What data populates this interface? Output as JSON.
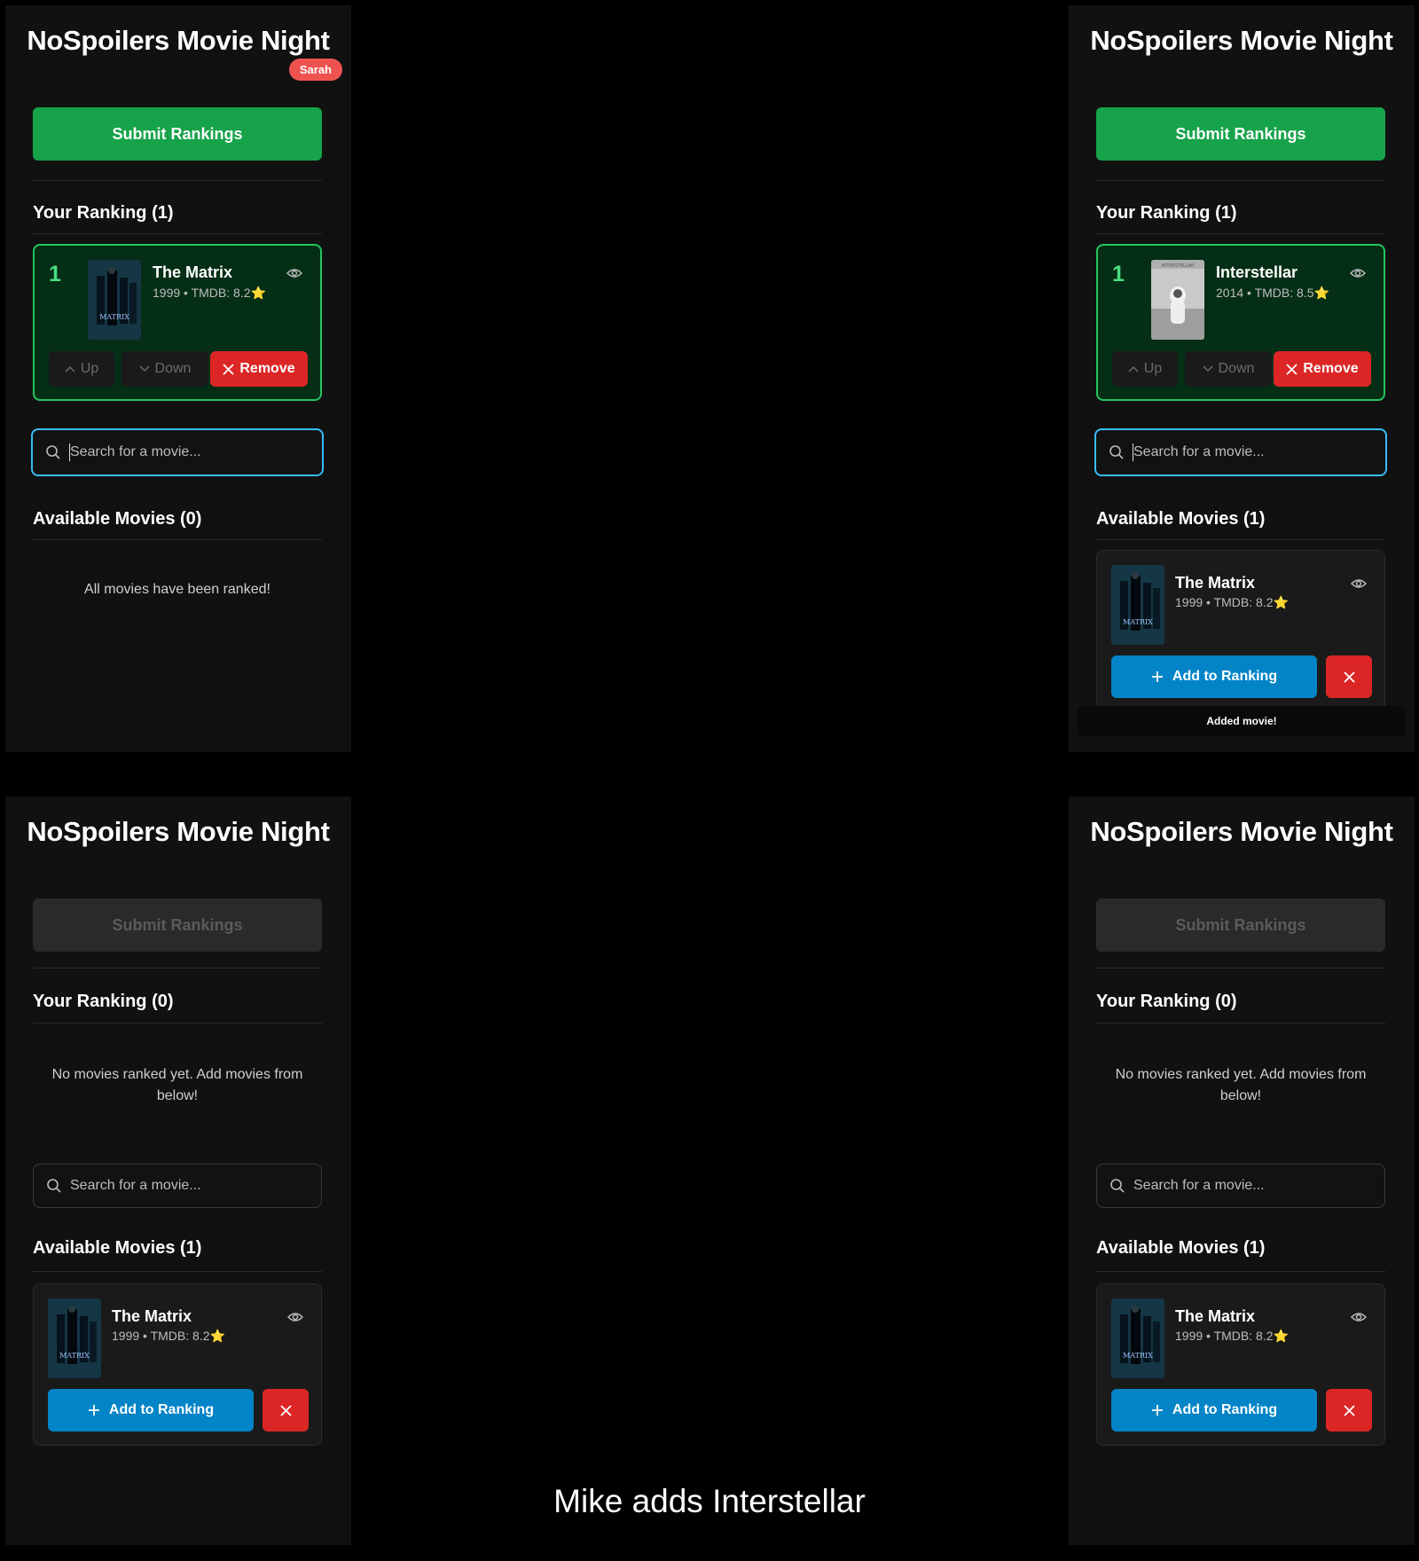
{
  "app": {
    "title": "NoSpoilers Movie Night"
  },
  "labels": {
    "submit": "Submit Rankings",
    "up": "Up",
    "down": "Down",
    "remove": "Remove",
    "add": "Add to Ranking",
    "search_placeholder": "Search for a movie...",
    "empty_ranking": "No movies ranked yet. Add movies from below!",
    "all_ranked": "All movies have been ranked!"
  },
  "panels": {
    "top_left": {
      "user": "Sarah",
      "ranking_header": "Your Ranking (1)",
      "available_header": "Available Movies (0)",
      "ranked": [
        {
          "rank": "1",
          "title": "The Matrix",
          "meta": "1999 • TMDB: 8.2⭐"
        }
      ]
    },
    "top_right": {
      "ranking_header": "Your Ranking (1)",
      "available_header": "Available Movies (1)",
      "ranked": [
        {
          "rank": "1",
          "title": "Interstellar",
          "meta": "2014 • TMDB: 8.5⭐"
        }
      ],
      "available": [
        {
          "title": "The Matrix",
          "meta": "1999 • TMDB: 8.2⭐"
        }
      ],
      "toast": "Added movie!"
    },
    "bottom_left": {
      "ranking_header": "Your Ranking (0)",
      "available_header": "Available Movies (1)",
      "available": [
        {
          "title": "The Matrix",
          "meta": "1999 • TMDB: 8.2⭐"
        }
      ]
    },
    "bottom_right": {
      "ranking_header": "Your Ranking (0)",
      "available_header": "Available Movies (1)",
      "available": [
        {
          "title": "The Matrix",
          "meta": "1999 • TMDB: 8.2⭐"
        }
      ]
    }
  },
  "caption": "Mike adds Interstellar",
  "colors": {
    "success": "#16a34a",
    "danger": "#dc2626",
    "primary": "#0284c7",
    "focus": "#38bdf8",
    "badge": "#ef5350"
  }
}
